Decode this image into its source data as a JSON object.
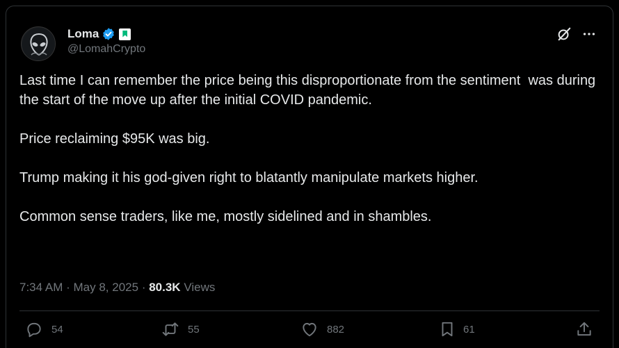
{
  "author": {
    "display_name": "Loma",
    "handle": "@LomahCrypto",
    "verified": true
  },
  "tweet": {
    "paragraphs": [
      "Last time I can remember the price being this disproportionate from the sentiment  was during the start of the move up after the initial COVID pandemic.",
      "Price reclaiming $95K was big.",
      "Trump making it his god-given right to blatantly manipulate markets higher.",
      "Common sense traders, like me, mostly sidelined and in shambles."
    ]
  },
  "meta": {
    "time": "7:34 AM",
    "separator": "·",
    "date": "May 8, 2025",
    "views_count": "80.3K",
    "views_label": "Views"
  },
  "actions": {
    "replies": "54",
    "reposts": "55",
    "likes": "882",
    "bookmarks": "61"
  },
  "colors": {
    "background": "#000000",
    "text": "#e7e9ea",
    "muted": "#71767b",
    "border": "#2f3336",
    "verified_blue": "#1d9bf0",
    "badge_green": "#00ba7c"
  },
  "icons": {
    "avatar": "alien-head-avatar",
    "verified": "verified-badge-icon",
    "affiliate": "bookmark-badge-icon",
    "grok": "grok-icon",
    "more": "more-icon",
    "reply": "reply-icon",
    "repost": "repost-icon",
    "like": "heart-icon",
    "bookmark": "bookmark-icon",
    "share": "share-icon"
  }
}
